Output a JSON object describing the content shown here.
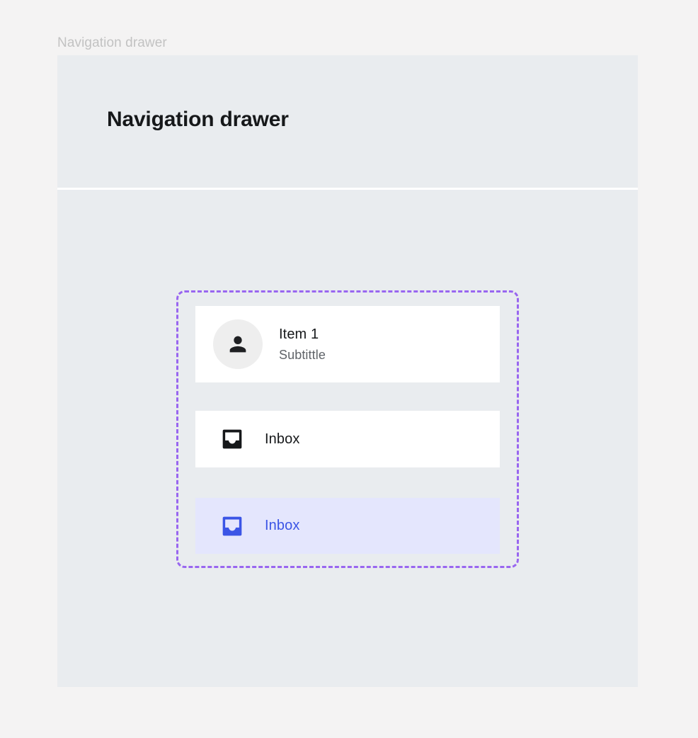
{
  "caption": {
    "label": "Navigation drawer"
  },
  "panel": {
    "header": {
      "title": "Navigation drawer"
    }
  },
  "list": {
    "items": [
      {
        "id": "item-1",
        "leading_icon": "person-avatar-icon",
        "primary": "Item 1",
        "secondary": "Subtittle",
        "selected": false
      },
      {
        "id": "inbox-default",
        "leading_icon": "inbox-icon",
        "primary": "Inbox",
        "secondary": "",
        "selected": false
      },
      {
        "id": "inbox-selected",
        "leading_icon": "inbox-icon",
        "primary": "Inbox",
        "secondary": "",
        "selected": true
      }
    ]
  },
  "colors": {
    "page_background": "#f4f3f3",
    "panel_background": "#e9ecef",
    "card_background": "#ffffff",
    "selected_background": "#e4e6fd",
    "accent_blue": "#3b55e6",
    "spec_outline_purple": "#9966f0",
    "avatar_background": "#eeeeee",
    "primary_text": "#16181a",
    "secondary_text": "#5f6368",
    "caption_text": "#c2c2c2"
  }
}
